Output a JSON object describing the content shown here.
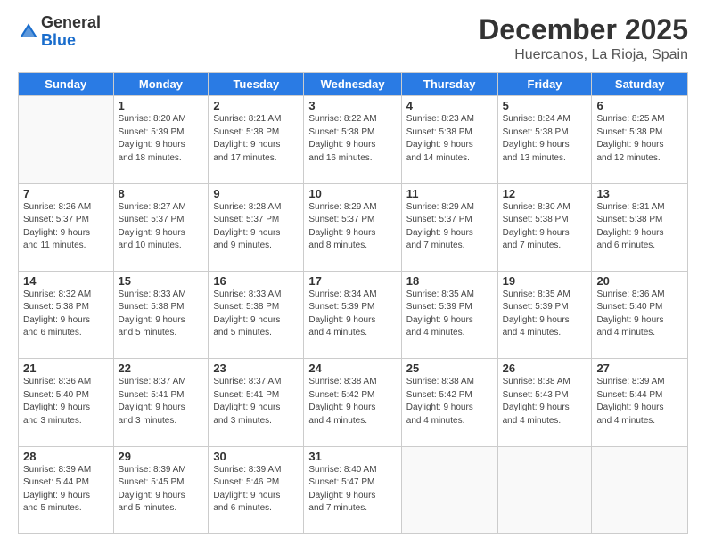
{
  "header": {
    "logo_general": "General",
    "logo_blue": "Blue",
    "month": "December 2025",
    "location": "Huercanos, La Rioja, Spain"
  },
  "days_of_week": [
    "Sunday",
    "Monday",
    "Tuesday",
    "Wednesday",
    "Thursday",
    "Friday",
    "Saturday"
  ],
  "weeks": [
    [
      {
        "day": "",
        "info": ""
      },
      {
        "day": "1",
        "info": "Sunrise: 8:20 AM\nSunset: 5:39 PM\nDaylight: 9 hours\nand 18 minutes."
      },
      {
        "day": "2",
        "info": "Sunrise: 8:21 AM\nSunset: 5:38 PM\nDaylight: 9 hours\nand 17 minutes."
      },
      {
        "day": "3",
        "info": "Sunrise: 8:22 AM\nSunset: 5:38 PM\nDaylight: 9 hours\nand 16 minutes."
      },
      {
        "day": "4",
        "info": "Sunrise: 8:23 AM\nSunset: 5:38 PM\nDaylight: 9 hours\nand 14 minutes."
      },
      {
        "day": "5",
        "info": "Sunrise: 8:24 AM\nSunset: 5:38 PM\nDaylight: 9 hours\nand 13 minutes."
      },
      {
        "day": "6",
        "info": "Sunrise: 8:25 AM\nSunset: 5:38 PM\nDaylight: 9 hours\nand 12 minutes."
      }
    ],
    [
      {
        "day": "7",
        "info": "Sunrise: 8:26 AM\nSunset: 5:37 PM\nDaylight: 9 hours\nand 11 minutes."
      },
      {
        "day": "8",
        "info": "Sunrise: 8:27 AM\nSunset: 5:37 PM\nDaylight: 9 hours\nand 10 minutes."
      },
      {
        "day": "9",
        "info": "Sunrise: 8:28 AM\nSunset: 5:37 PM\nDaylight: 9 hours\nand 9 minutes."
      },
      {
        "day": "10",
        "info": "Sunrise: 8:29 AM\nSunset: 5:37 PM\nDaylight: 9 hours\nand 8 minutes."
      },
      {
        "day": "11",
        "info": "Sunrise: 8:29 AM\nSunset: 5:37 PM\nDaylight: 9 hours\nand 7 minutes."
      },
      {
        "day": "12",
        "info": "Sunrise: 8:30 AM\nSunset: 5:38 PM\nDaylight: 9 hours\nand 7 minutes."
      },
      {
        "day": "13",
        "info": "Sunrise: 8:31 AM\nSunset: 5:38 PM\nDaylight: 9 hours\nand 6 minutes."
      }
    ],
    [
      {
        "day": "14",
        "info": "Sunrise: 8:32 AM\nSunset: 5:38 PM\nDaylight: 9 hours\nand 6 minutes."
      },
      {
        "day": "15",
        "info": "Sunrise: 8:33 AM\nSunset: 5:38 PM\nDaylight: 9 hours\nand 5 minutes."
      },
      {
        "day": "16",
        "info": "Sunrise: 8:33 AM\nSunset: 5:38 PM\nDaylight: 9 hours\nand 5 minutes."
      },
      {
        "day": "17",
        "info": "Sunrise: 8:34 AM\nSunset: 5:39 PM\nDaylight: 9 hours\nand 4 minutes."
      },
      {
        "day": "18",
        "info": "Sunrise: 8:35 AM\nSunset: 5:39 PM\nDaylight: 9 hours\nand 4 minutes."
      },
      {
        "day": "19",
        "info": "Sunrise: 8:35 AM\nSunset: 5:39 PM\nDaylight: 9 hours\nand 4 minutes."
      },
      {
        "day": "20",
        "info": "Sunrise: 8:36 AM\nSunset: 5:40 PM\nDaylight: 9 hours\nand 4 minutes."
      }
    ],
    [
      {
        "day": "21",
        "info": "Sunrise: 8:36 AM\nSunset: 5:40 PM\nDaylight: 9 hours\nand 3 minutes."
      },
      {
        "day": "22",
        "info": "Sunrise: 8:37 AM\nSunset: 5:41 PM\nDaylight: 9 hours\nand 3 minutes."
      },
      {
        "day": "23",
        "info": "Sunrise: 8:37 AM\nSunset: 5:41 PM\nDaylight: 9 hours\nand 3 minutes."
      },
      {
        "day": "24",
        "info": "Sunrise: 8:38 AM\nSunset: 5:42 PM\nDaylight: 9 hours\nand 4 minutes."
      },
      {
        "day": "25",
        "info": "Sunrise: 8:38 AM\nSunset: 5:42 PM\nDaylight: 9 hours\nand 4 minutes."
      },
      {
        "day": "26",
        "info": "Sunrise: 8:38 AM\nSunset: 5:43 PM\nDaylight: 9 hours\nand 4 minutes."
      },
      {
        "day": "27",
        "info": "Sunrise: 8:39 AM\nSunset: 5:44 PM\nDaylight: 9 hours\nand 4 minutes."
      }
    ],
    [
      {
        "day": "28",
        "info": "Sunrise: 8:39 AM\nSunset: 5:44 PM\nDaylight: 9 hours\nand 5 minutes."
      },
      {
        "day": "29",
        "info": "Sunrise: 8:39 AM\nSunset: 5:45 PM\nDaylight: 9 hours\nand 5 minutes."
      },
      {
        "day": "30",
        "info": "Sunrise: 8:39 AM\nSunset: 5:46 PM\nDaylight: 9 hours\nand 6 minutes."
      },
      {
        "day": "31",
        "info": "Sunrise: 8:40 AM\nSunset: 5:47 PM\nDaylight: 9 hours\nand 7 minutes."
      },
      {
        "day": "",
        "info": ""
      },
      {
        "day": "",
        "info": ""
      },
      {
        "day": "",
        "info": ""
      }
    ]
  ]
}
